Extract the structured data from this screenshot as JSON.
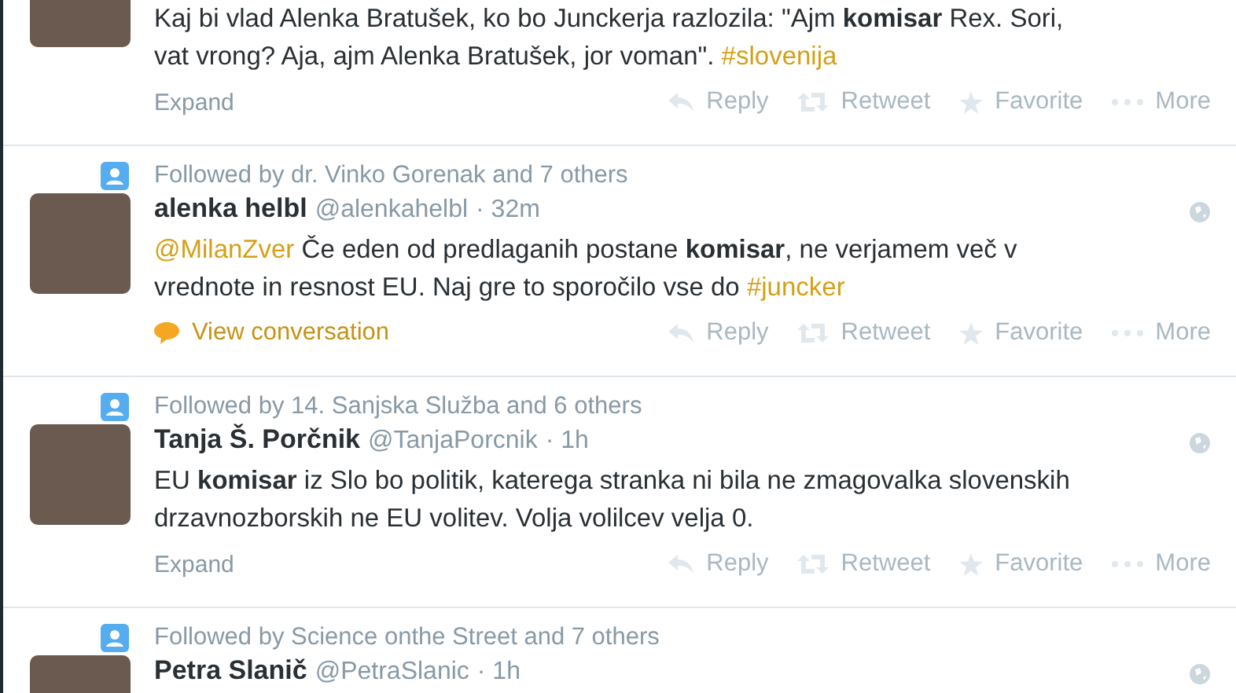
{
  "tweets": [
    {
      "lines": [
        [
          {
            "kind": "text",
            "text": "Kaj bi vlad Alenka Bratušek, ko bo Junckerja razlozila: \"Ajm "
          },
          {
            "kind": "bold",
            "text": "komisar"
          },
          {
            "kind": "text",
            "text": " Rex. Sori,"
          }
        ],
        [
          {
            "kind": "text",
            "text": "vat vrong? Aja, ajm Alenka Bratušek, jor voman\". "
          },
          {
            "kind": "link",
            "text": "#slovenija"
          }
        ]
      ],
      "footer": {
        "kind": "expand",
        "label": "Expand"
      },
      "actions": [
        "Reply",
        "Retweet",
        "Favorite",
        "More"
      ]
    },
    {
      "followed_by": "Followed by dr. Vinko Gorenak and 7 others",
      "name": "alenka helbl",
      "handle": "@alenkahelbl",
      "time": "· 32m",
      "lines": [
        [
          {
            "kind": "link",
            "text": "@MilanZver"
          },
          {
            "kind": "text",
            "text": " Če eden od predlaganih postane "
          },
          {
            "kind": "bold",
            "text": "komisar"
          },
          {
            "kind": "text",
            "text": ", ne verjamem več v"
          }
        ],
        [
          {
            "kind": "text",
            "text": "vrednote in resnost EU. Naj gre to sporočilo vse do "
          },
          {
            "kind": "link",
            "text": "#juncker"
          }
        ]
      ],
      "footer": {
        "kind": "conversation",
        "label": "View conversation"
      },
      "actions": [
        "Reply",
        "Retweet",
        "Favorite",
        "More"
      ]
    },
    {
      "followed_by": "Followed by 14. Sanjska Služba and 6 others",
      "name": "Tanja Š. Porčnik",
      "handle": "@TanjaPorcnik",
      "time": "· 1h",
      "lines": [
        [
          {
            "kind": "text",
            "text": "EU "
          },
          {
            "kind": "bold",
            "text": "komisar"
          },
          {
            "kind": "text",
            "text": " iz Slo bo politik, katerega stranka ni bila ne zmagovalka slovenskih"
          }
        ],
        [
          {
            "kind": "text",
            "text": "drzavnozborskih ne EU volitev. Volja volilcev velja 0."
          }
        ]
      ],
      "footer": {
        "kind": "expand",
        "label": "Expand"
      },
      "actions": [
        "Reply",
        "Retweet",
        "Favorite",
        "More"
      ]
    },
    {
      "followed_by": "Followed by Science onthe Street and 7 others",
      "name": "Petra Slanič",
      "handle": "@PetraSlanic",
      "time": "· 1h"
    }
  ]
}
